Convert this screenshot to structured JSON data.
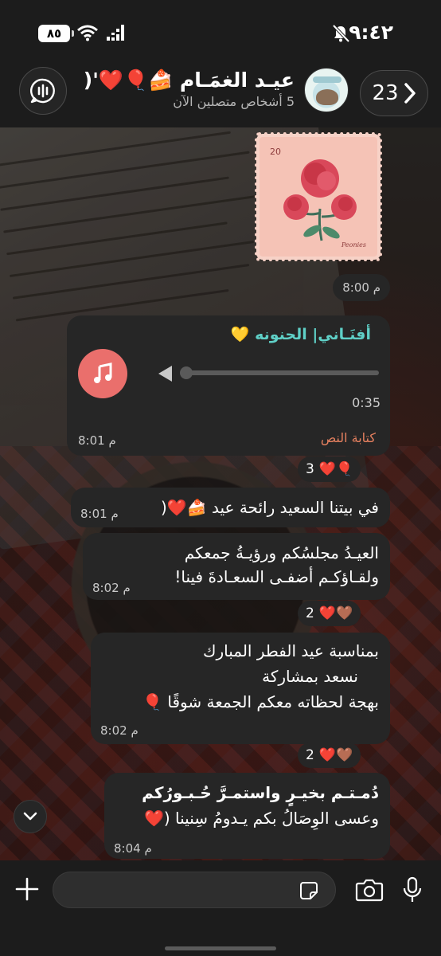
{
  "status_bar": {
    "time": "٩:٤٢",
    "battery": "٨٥"
  },
  "header": {
    "back_count": "23",
    "title": "عيـد الغمَـام 🍰🎈❤️'(",
    "subtitle": "5 أشخاص متصلين الآن"
  },
  "messages": [
    {
      "type": "sticker",
      "stamp_number": "20",
      "stamp_word": "Peonies",
      "time": "8:00 م"
    },
    {
      "type": "audio",
      "title": "أفنَـاني| الحنونه 💛",
      "duration": "0:35",
      "transcript_label": "كتابة النص",
      "time": "8:01 م",
      "reactions": {
        "emojis": "🎈❤️",
        "count": "3"
      }
    },
    {
      "type": "text",
      "lines": [
        "في بيتنا السعيد رائحة عيد 🍰❤️("
      ],
      "time": "8:01 م"
    },
    {
      "type": "text",
      "lines": [
        "العيـدُ مجلسُكم ورؤيـةُ جمعكم",
        "ولقـاؤكـم أضفـى السعـادةَ فينا!"
      ],
      "time": "8:02 م",
      "reactions": {
        "emojis": "🤎❤️",
        "count": "2"
      }
    },
    {
      "type": "text",
      "lines": [
        "بمناسبة عيد الفطر المبارك",
        "نسعد بمشاركة",
        "بهجة لحظاته معكم الجمعة شوقًا 🎈"
      ],
      "time": "8:02 م",
      "reactions": {
        "emojis": "🤎❤️",
        "count": "2"
      }
    },
    {
      "type": "text",
      "lines": [
        "دُمـتـم بخيـرٍ واستمـرَّ حُـبـورُكم",
        "وعسى الوِصَالُ بكم يـدومُ سِنينا (❤️"
      ],
      "time": "8:04 م"
    }
  ],
  "composer": {
    "placeholder": ""
  },
  "colors": {
    "bubble": "#262626",
    "bar": "#1c1c1c",
    "audio_accent": "#ea6f6c",
    "audio_title": "#5fd0c7",
    "transcript": "#e6805f"
  },
  "icons": [
    "mute-icon",
    "wifi-icon",
    "signal-icon",
    "chevron-right-icon",
    "voice-chat-icon",
    "music-note-icon",
    "play-back-icon",
    "chevron-down-icon",
    "plus-icon",
    "sticker-icon",
    "camera-icon",
    "mic-icon"
  ]
}
